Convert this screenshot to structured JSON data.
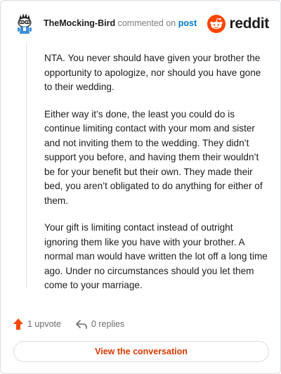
{
  "header": {
    "author": "TheMocking-Bird",
    "commented_text": "commented on",
    "post_link": "post",
    "logo_text": "reddit"
  },
  "comment": {
    "paragraphs": [
      "NTA. You never should have given your brother the opportunity to apologize, nor should you have gone to their wedding.",
      "Either way it’s done, the least you could do is continue limiting contact with your mom and sister and not inviting them to the wedding. They didn’t support you before, and having them their wouldn’t be for your benefit but their own. They made their bed, you aren’t obligated to do anything for either of them.",
      "Your gift is limiting contact instead of outright ignoring them like you have with your brother. A normal man would have written the lot off a long time ago. Under no circumstances should you let them come to your marriage."
    ]
  },
  "actions": {
    "upvotes": "1 upvote",
    "replies": "0 replies"
  },
  "cta": {
    "label": "View the conversation"
  },
  "colors": {
    "brand": "#ff4500",
    "link": "#0079d3",
    "cta_text": "#d93900"
  }
}
